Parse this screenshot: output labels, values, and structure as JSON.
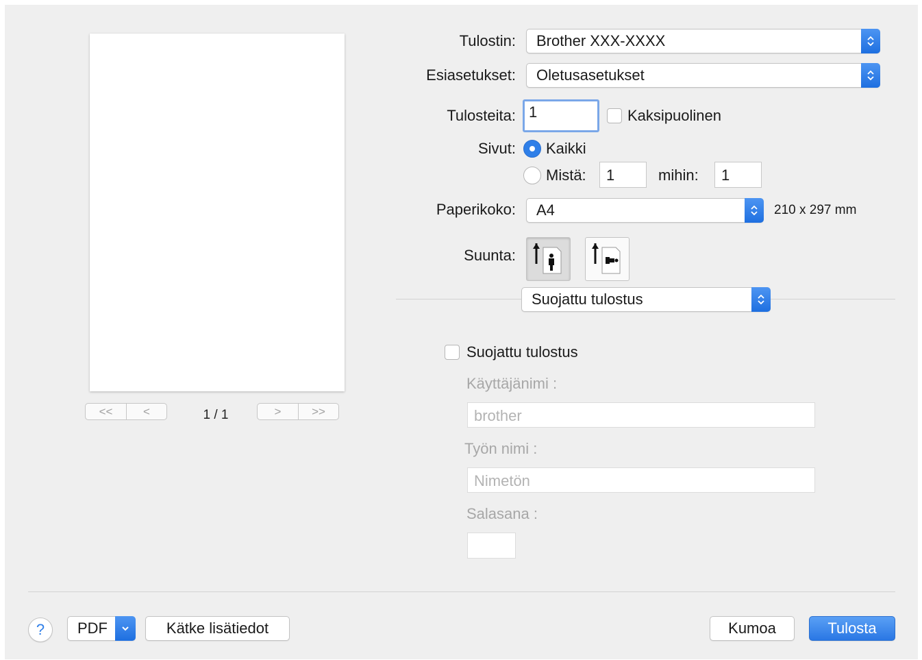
{
  "preview": {
    "page_indicator": "1 / 1",
    "nav": {
      "first": "<<",
      "prev": "<",
      "next": ">",
      "last": ">>"
    }
  },
  "printer": {
    "label": "Tulostin:",
    "value": "Brother  XXX-XXXX"
  },
  "presets": {
    "label": "Esiasetukset:",
    "value": "Oletusasetukset"
  },
  "copies": {
    "label": "Tulosteita:",
    "value": "1",
    "two_sided_label": "Kaksipuolinen",
    "two_sided_checked": false
  },
  "pages": {
    "label": "Sivut:",
    "all_label": "Kaikki",
    "all_selected": true,
    "from_label": "Mistä:",
    "from_value": "1",
    "to_label": "mihin:",
    "to_value": "1"
  },
  "paper_size": {
    "label": "Paperikoko:",
    "value": "A4",
    "dimensions": "210 x 297 mm"
  },
  "orientation": {
    "label": "Suunta:",
    "options": [
      "portrait",
      "landscape"
    ],
    "selected": "portrait"
  },
  "section": {
    "value": "Suojattu tulostus"
  },
  "secure_print": {
    "checkbox_label": "Suojattu tulostus",
    "checked": false,
    "username_label": "Käyttäjänimi :",
    "username_value": "brother",
    "job_name_label": "Työn nimi :",
    "job_name_value": "Nimetön",
    "password_label": "Salasana :",
    "password_value": ""
  },
  "footer": {
    "help": "?",
    "pdf": "PDF",
    "hide_details": "Kätke lisätiedot",
    "cancel": "Kumoa",
    "print": "Tulosta"
  },
  "colors": {
    "accent": "#2f7fe8",
    "background": "#efefef",
    "disabled_text": "#a7a7a7"
  }
}
